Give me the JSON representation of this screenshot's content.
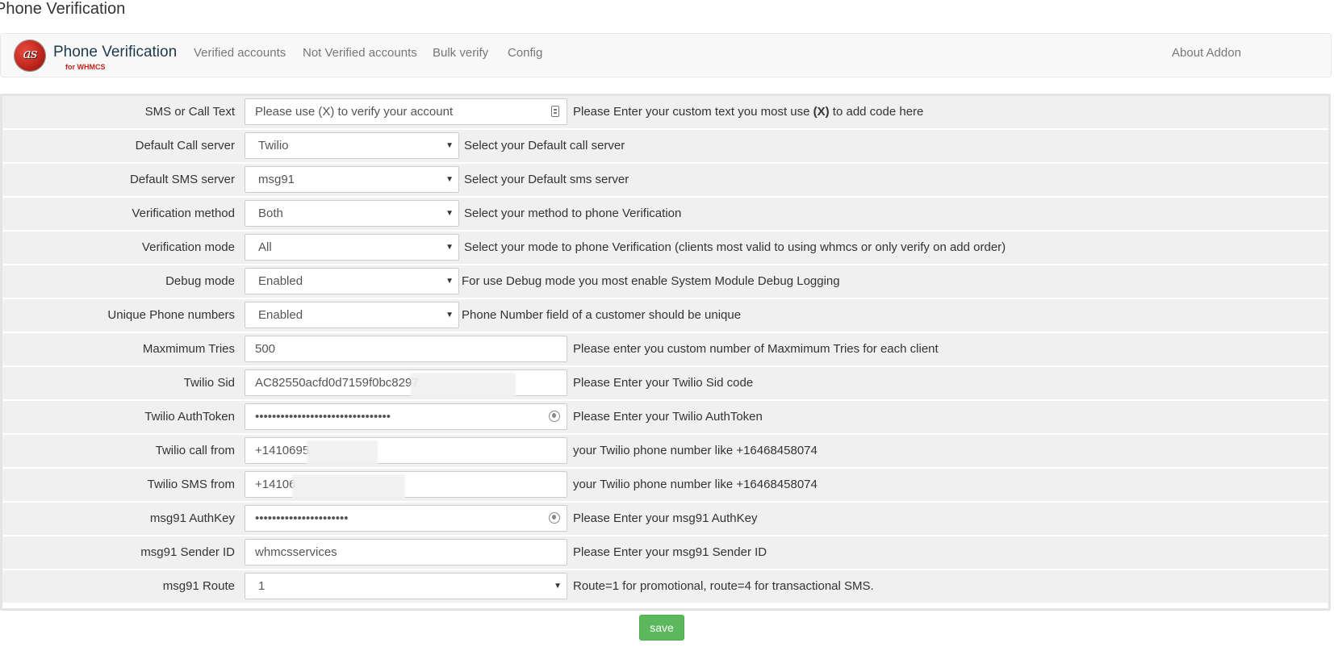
{
  "page_title": "Phone Verification",
  "brand": {
    "title": "Phone Verification",
    "subtitle": "for WHMCS",
    "logo_text": "as"
  },
  "nav": {
    "items": [
      "Verified accounts",
      "Not Verified accounts",
      "Bulk verify",
      "Config"
    ],
    "about": "About Addon"
  },
  "form": {
    "sms_text": {
      "label": "SMS or Call Text",
      "value": "Please use (X) to verify your account",
      "help_pre": "Please Enter your custom text you most use ",
      "help_bold": "(X)",
      "help_post": " to add code here"
    },
    "call_server": {
      "label": "Default Call server",
      "value": "Twilio",
      "help": "Select your Default call server"
    },
    "sms_server": {
      "label": "Default SMS server",
      "value": "msg91",
      "help": "Select your Default sms server"
    },
    "verify_method": {
      "label": "Verification method",
      "value": "Both",
      "help": "Select your method to phone Verification"
    },
    "verify_mode": {
      "label": "Verification mode",
      "value": "All",
      "help": "Select your mode to phone Verification (clients most valid to using whmcs or only verify on add order)"
    },
    "debug_mode": {
      "label": "Debug mode",
      "value": "Enabled",
      "help": "For use Debug mode you most enable System Module Debug Logging"
    },
    "unique_phone": {
      "label": "Unique Phone numbers",
      "value": "Enabled",
      "help": "Phone Number field of a customer should be unique"
    },
    "max_tries": {
      "label": "Maxmimum Tries",
      "value": "500",
      "help": "Please enter you custom number of Maxmimum Tries for each client"
    },
    "twilio_sid": {
      "label": "Twilio Sid",
      "value": "AC82550acfd0d7159f0bc8297",
      "help": "Please Enter your Twilio Sid code"
    },
    "twilio_token": {
      "label": "Twilio AuthToken",
      "value": "••••••••••••••••••••••••••••••••",
      "help": "Please Enter your Twilio AuthToken"
    },
    "twilio_call_from": {
      "label": "Twilio call from",
      "value": "+1410695",
      "help": "your Twilio phone number like +16468458074"
    },
    "twilio_sms_from": {
      "label": "Twilio SMS from",
      "value": "+14106",
      "help": "your Twilio phone number like +16468458074"
    },
    "msg91_key": {
      "label": "msg91 AuthKey",
      "value": "••••••••••••••••••••••",
      "help": "Please Enter your msg91 AuthKey"
    },
    "msg91_sender": {
      "label": "msg91 Sender ID",
      "value": "whmcsservices",
      "help": "Please Enter your msg91 Sender ID"
    },
    "msg91_route": {
      "label": "msg91 Route",
      "value": "1",
      "help": "Route=1 for promotional, route=4 for transactional SMS."
    }
  },
  "save_label": "save"
}
